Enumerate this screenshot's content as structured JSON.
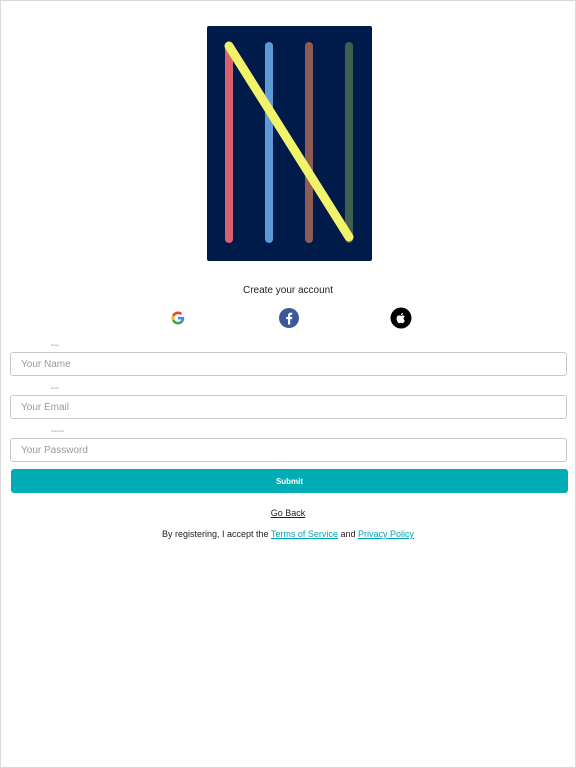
{
  "heading": "Create your account",
  "social": {
    "google": "google-icon",
    "facebook": "facebook-icon",
    "apple": "apple-icon"
  },
  "form": {
    "name_caption": "Name",
    "name_placeholder": "Your Name",
    "email_caption": "Email",
    "email_placeholder": "Your Email",
    "password_caption": "Password",
    "password_placeholder": "Your Password",
    "submit_label": "Submit"
  },
  "go_back": "Go Back",
  "terms": {
    "prefix": "By registering, I accept the",
    "terms_link": "Terms of Service",
    "and": "and",
    "privacy_link": "Privacy Policy"
  },
  "colors": {
    "logo_bg": "#001a4a",
    "accent": "#00adb5",
    "link": "#00a3b5",
    "stripe_red": "#d9606e",
    "stripe_blue": "#5b9bd5",
    "stripe_brown": "#8c5c55",
    "stripe_green": "#3f5f4f",
    "stripe_yellow": "#f2f26b"
  }
}
